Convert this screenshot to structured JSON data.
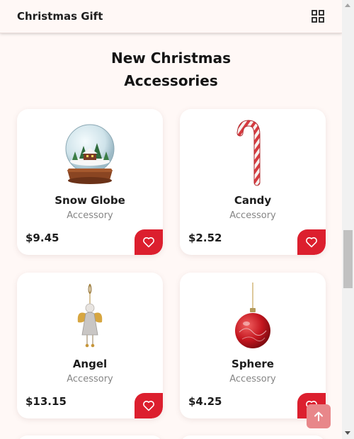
{
  "header": {
    "logo": "Christmas Gift",
    "menu_icon": "grid-icon"
  },
  "section": {
    "title_line1": "New Christmas",
    "title_line2": "Accessories"
  },
  "products": [
    {
      "name": "Snow Globe",
      "category": "Accessory",
      "price": "$9.45",
      "icon": "snow-globe-icon"
    },
    {
      "name": "Candy",
      "category": "Accessory",
      "price": "$2.52",
      "icon": "candy-cane-icon"
    },
    {
      "name": "Angel",
      "category": "Accessory",
      "price": "$13.15",
      "icon": "angel-ornament-icon"
    },
    {
      "name": "Sphere",
      "category": "Accessory",
      "price": "$4.25",
      "icon": "ornament-ball-icon"
    }
  ],
  "colors": {
    "accent": "#dc1f2e",
    "background": "#fff8f6",
    "scroll_top_button": "#e8878a"
  }
}
